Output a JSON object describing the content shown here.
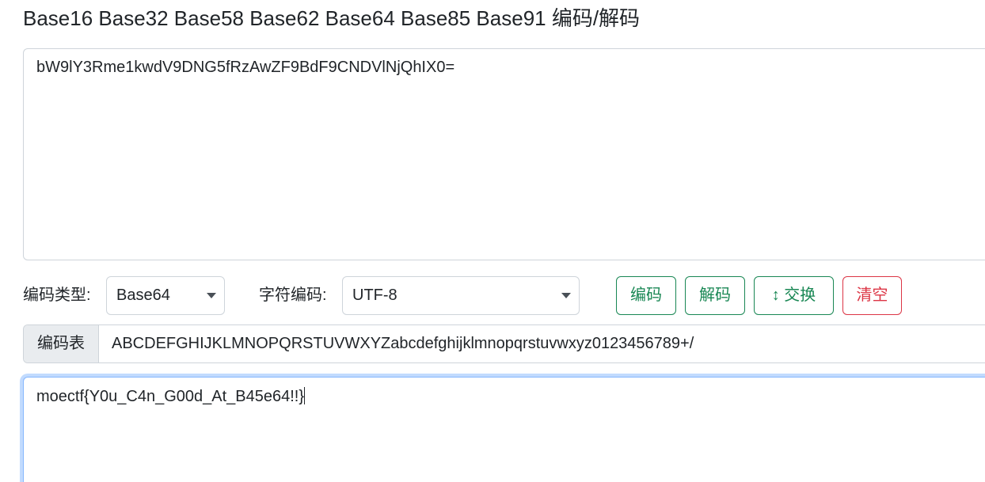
{
  "page_title": "Base16 Base32 Base58 Base62 Base64 Base85 Base91 编码/解码",
  "input": {
    "value": "bW9lY3Rme1kwdV9DNG5fRzAwZF9BdF9CNDVlNjQhIX0="
  },
  "controls": {
    "encoding_type_label": "编码类型:",
    "encoding_type_value": "Base64",
    "charset_label": "字符编码:",
    "charset_value": "UTF-8",
    "encode_button": "编码",
    "decode_button": "解码",
    "swap_icon": "↕",
    "swap_button": "交换",
    "clear_button": "清空"
  },
  "alphabet": {
    "label": "编码表",
    "value": "ABCDEFGHIJKLMNOPQRSTUVWXYZabcdefghijklmnopqrstuvwxyz0123456789+/"
  },
  "output": {
    "value": "moectf{Y0u_C4n_G00d_At_B45e64!!}"
  },
  "colors": {
    "success": "#198754",
    "danger": "#dc3545",
    "focus_border": "#86b7fe"
  }
}
